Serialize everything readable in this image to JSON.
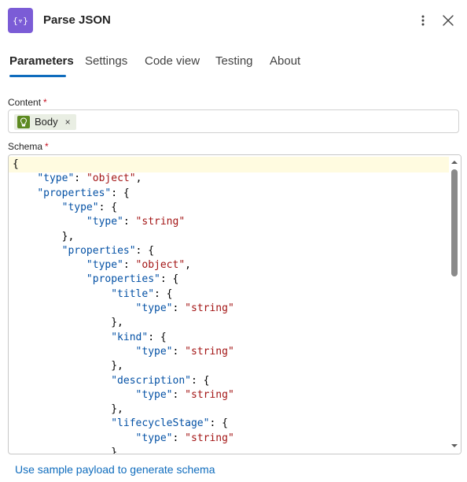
{
  "header": {
    "title": "Parse JSON",
    "icon": "data-operation-icon",
    "icon_color": "#7b5cd6"
  },
  "tabs": [
    {
      "label": "Parameters",
      "active": true
    },
    {
      "label": "Settings",
      "active": false
    },
    {
      "label": "Code view",
      "active": false
    },
    {
      "label": "Testing",
      "active": false
    },
    {
      "label": "About",
      "active": false
    }
  ],
  "content_field": {
    "label": "Content",
    "required_mark": "*",
    "token": {
      "label": "Body",
      "remove": "×",
      "icon": "trigger-icon",
      "icon_color": "#5d8a20"
    }
  },
  "schema_field": {
    "label": "Schema",
    "required_mark": "*",
    "lines": [
      {
        "indent": 0,
        "parts": [
          {
            "t": "p",
            "v": "{"
          }
        ]
      },
      {
        "indent": 1,
        "parts": [
          {
            "t": "k",
            "v": "\"type\""
          },
          {
            "t": "p",
            "v": ": "
          },
          {
            "t": "s",
            "v": "\"object\""
          },
          {
            "t": "p",
            "v": ","
          }
        ]
      },
      {
        "indent": 1,
        "parts": [
          {
            "t": "k",
            "v": "\"properties\""
          },
          {
            "t": "p",
            "v": ": {"
          }
        ]
      },
      {
        "indent": 2,
        "parts": [
          {
            "t": "k",
            "v": "\"type\""
          },
          {
            "t": "p",
            "v": ": {"
          }
        ]
      },
      {
        "indent": 3,
        "parts": [
          {
            "t": "k",
            "v": "\"type\""
          },
          {
            "t": "p",
            "v": ": "
          },
          {
            "t": "s",
            "v": "\"string\""
          }
        ]
      },
      {
        "indent": 2,
        "parts": [
          {
            "t": "p",
            "v": "},"
          }
        ]
      },
      {
        "indent": 2,
        "parts": [
          {
            "t": "k",
            "v": "\"properties\""
          },
          {
            "t": "p",
            "v": ": {"
          }
        ]
      },
      {
        "indent": 3,
        "parts": [
          {
            "t": "k",
            "v": "\"type\""
          },
          {
            "t": "p",
            "v": ": "
          },
          {
            "t": "s",
            "v": "\"object\""
          },
          {
            "t": "p",
            "v": ","
          }
        ]
      },
      {
        "indent": 3,
        "parts": [
          {
            "t": "k",
            "v": "\"properties\""
          },
          {
            "t": "p",
            "v": ": {"
          }
        ]
      },
      {
        "indent": 4,
        "parts": [
          {
            "t": "k",
            "v": "\"title\""
          },
          {
            "t": "p",
            "v": ": {"
          }
        ]
      },
      {
        "indent": 5,
        "parts": [
          {
            "t": "k",
            "v": "\"type\""
          },
          {
            "t": "p",
            "v": ": "
          },
          {
            "t": "s",
            "v": "\"string\""
          }
        ]
      },
      {
        "indent": 4,
        "parts": [
          {
            "t": "p",
            "v": "},"
          }
        ]
      },
      {
        "indent": 4,
        "parts": [
          {
            "t": "k",
            "v": "\"kind\""
          },
          {
            "t": "p",
            "v": ": {"
          }
        ]
      },
      {
        "indent": 5,
        "parts": [
          {
            "t": "k",
            "v": "\"type\""
          },
          {
            "t": "p",
            "v": ": "
          },
          {
            "t": "s",
            "v": "\"string\""
          }
        ]
      },
      {
        "indent": 4,
        "parts": [
          {
            "t": "p",
            "v": "},"
          }
        ]
      },
      {
        "indent": 4,
        "parts": [
          {
            "t": "k",
            "v": "\"description\""
          },
          {
            "t": "p",
            "v": ": {"
          }
        ]
      },
      {
        "indent": 5,
        "parts": [
          {
            "t": "k",
            "v": "\"type\""
          },
          {
            "t": "p",
            "v": ": "
          },
          {
            "t": "s",
            "v": "\"string\""
          }
        ]
      },
      {
        "indent": 4,
        "parts": [
          {
            "t": "p",
            "v": "},"
          }
        ]
      },
      {
        "indent": 4,
        "parts": [
          {
            "t": "k",
            "v": "\"lifecycleStage\""
          },
          {
            "t": "p",
            "v": ": {"
          }
        ]
      },
      {
        "indent": 5,
        "parts": [
          {
            "t": "k",
            "v": "\"type\""
          },
          {
            "t": "p",
            "v": ": "
          },
          {
            "t": "s",
            "v": "\"string\""
          }
        ]
      },
      {
        "indent": 4,
        "parts": [
          {
            "t": "p",
            "v": "}"
          }
        ]
      }
    ],
    "key_color": "#0451a5",
    "string_color": "#a31515"
  },
  "footer": {
    "sample_link": "Use sample payload to generate schema"
  }
}
